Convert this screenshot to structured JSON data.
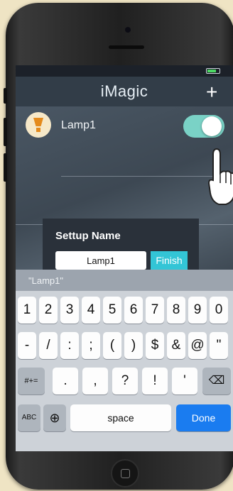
{
  "app": {
    "title": "iMagic",
    "add_icon": "+",
    "status": {
      "carrier": "",
      "time": ""
    }
  },
  "lamp_list": [
    {
      "label": "Lamp1",
      "toggle_on": true
    }
  ],
  "dialog": {
    "title": "Settup Name",
    "input_value": "Lamp1",
    "finish_label": "Finish"
  },
  "keyboard": {
    "suggestion": "\"Lamp1\"",
    "row1": [
      "1",
      "2",
      "3",
      "4",
      "5",
      "6",
      "7",
      "8",
      "9",
      "0"
    ],
    "row2": [
      "-",
      "/",
      ":",
      ";",
      "(",
      ")",
      "$",
      "&",
      "@",
      "\""
    ],
    "row3": [
      ".",
      ",",
      "?",
      "!",
      "'"
    ],
    "mode_key": "#+=",
    "abc_key": "ABC",
    "globe_icon": "⊕",
    "space_key": "space",
    "done_key": "Done",
    "backspace_icon": "⌫"
  },
  "colors": {
    "accent": "#33c5d6",
    "toggle_on": "#7ad2c6",
    "done_blue": "#1a7cf0"
  }
}
